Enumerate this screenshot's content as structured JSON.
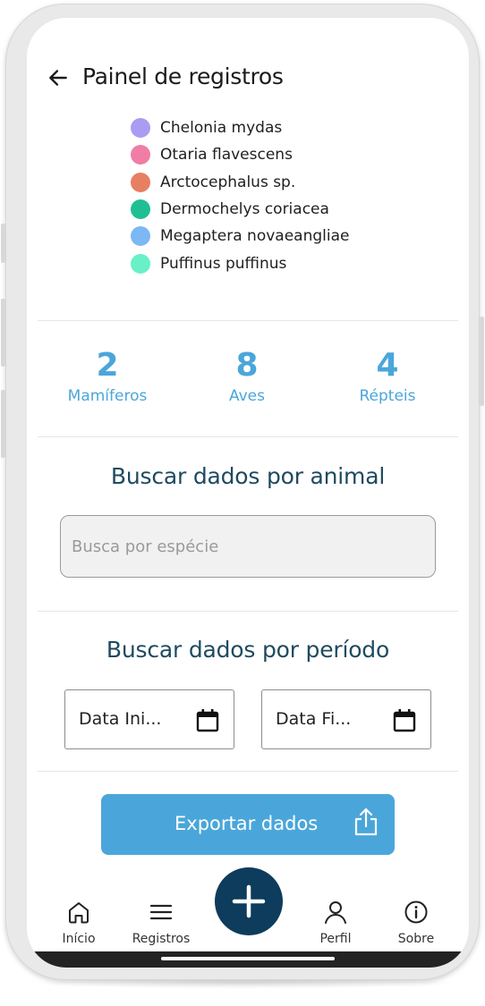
{
  "header": {
    "title": "Painel de registros"
  },
  "legend": {
    "items": [
      {
        "label": "Chelonia mydas",
        "color": "#a99cf2"
      },
      {
        "label": "Otaria flavescens",
        "color": "#f07da6"
      },
      {
        "label": "Arctocephalus sp.",
        "color": "#e77f63"
      },
      {
        "label": "Dermochelys coriacea",
        "color": "#1fbf96"
      },
      {
        "label": "Megaptera novaeangliae",
        "color": "#7cb8f3"
      },
      {
        "label": "Puffinus puffinus",
        "color": "#68f0c6"
      }
    ]
  },
  "stats": [
    {
      "value": "2",
      "label": "Mamíferos"
    },
    {
      "value": "8",
      "label": "Aves"
    },
    {
      "value": "4",
      "label": "Répteis"
    }
  ],
  "search_section": {
    "title": "Buscar dados por animal",
    "placeholder": "Busca por espécie",
    "value": ""
  },
  "period_section": {
    "title": "Buscar dados por período",
    "start_date": "Data Ini...",
    "end_date": "Data Fi..."
  },
  "export": {
    "label": "Exportar dados"
  },
  "colors": {
    "accent": "#4aa6da",
    "dark": "#0d3c5c",
    "heading": "#1f4a60"
  },
  "nav": {
    "items": [
      {
        "label": "Início",
        "icon": "home-icon"
      },
      {
        "label": "Registros",
        "icon": "menu-icon"
      },
      {
        "label": "Perfil",
        "icon": "user-icon"
      },
      {
        "label": "Sobre",
        "icon": "info-icon"
      }
    ],
    "fab_icon": "plus-icon"
  }
}
